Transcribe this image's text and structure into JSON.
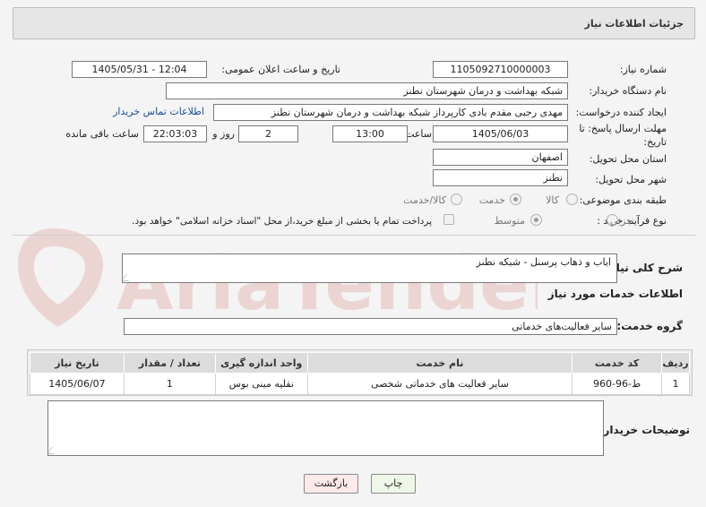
{
  "header": {
    "title": "جزئیات اطلاعات نیاز"
  },
  "fields": {
    "need_number_label": "شماره نیاز:",
    "need_number": "1105092710000003",
    "announce_label": "تاریخ و ساعت اعلان عمومی:",
    "announce_value": "1405/05/31 - 12:04",
    "buyer_org_label": "نام دستگاه خریدار:",
    "buyer_org": "شبکه بهداشت و درمان شهرستان نطنز",
    "requester_label": "ایجاد کننده درخواست:",
    "requester": "مهدی رجبی مقدم بادی کارپرداز شبکه بهداشت و درمان شهرستان نطنز",
    "contact_link": "اطلاعات تماس خریدار",
    "deadline_label_1": "مهلت ارسال پاسخ: تا",
    "deadline_label_2": "تاریخ:",
    "deadline_date": "1405/06/03",
    "time_label": "ساعت",
    "deadline_time": "13:00",
    "days_value": "2",
    "days_label": "روز و",
    "remaining_time": "22:03:03",
    "remaining_label": "ساعت باقی مانده",
    "province_label": "استان محل تحویل:",
    "province": "اصفهان",
    "city_label": "شهر محل تحویل:",
    "city": "نطنز",
    "category_label": "طبقه بندی موضوعی:",
    "category_options": [
      "کالا",
      "خدمت",
      "کالا/خدمت"
    ],
    "category_selected": "خدمت",
    "process_label": "نوع فرآیند خرید :",
    "process_options": [
      "جزیی",
      "متوسط"
    ],
    "process_selected": "متوسط",
    "payment_note": "پرداخت تمام یا بخشی از مبلغ خرید،از محل \"اسناد خزانه اسلامی\" خواهد بود."
  },
  "description": {
    "label": "شرح کلی نیاز:",
    "value": "ایاب و ذهاب پرسنل - شبکه نطنز"
  },
  "services": {
    "section_title": "اطلاعات خدمات مورد نیاز",
    "group_label": "گروه خدمت:",
    "group_value": "سایر فعالیت‌های خدماتی",
    "columns": [
      "ردیف",
      "کد خدمت",
      "نام خدمت",
      "واحد اندازه گیری",
      "تعداد / مقدار",
      "تاریخ نیاز"
    ],
    "rows": [
      {
        "row": "1",
        "code": "ط-96-960",
        "name": "سایر فعالیت های خدماتی شخصی",
        "unit": "نقلیه مینی بوس",
        "qty": "1",
        "date": "1405/06/07"
      }
    ]
  },
  "buyer_notes": {
    "label": "توضیحات خریدار:",
    "value": ""
  },
  "buttons": {
    "print": "چاپ",
    "back": "بازگشت"
  },
  "watermark": {
    "text": "AriaTender.neT"
  },
  "colors": {
    "link": "#1a4fa0",
    "back_button_bg": "#fde9e9",
    "print_button_bg": "#eef7e8",
    "watermark": "#c0392b"
  }
}
